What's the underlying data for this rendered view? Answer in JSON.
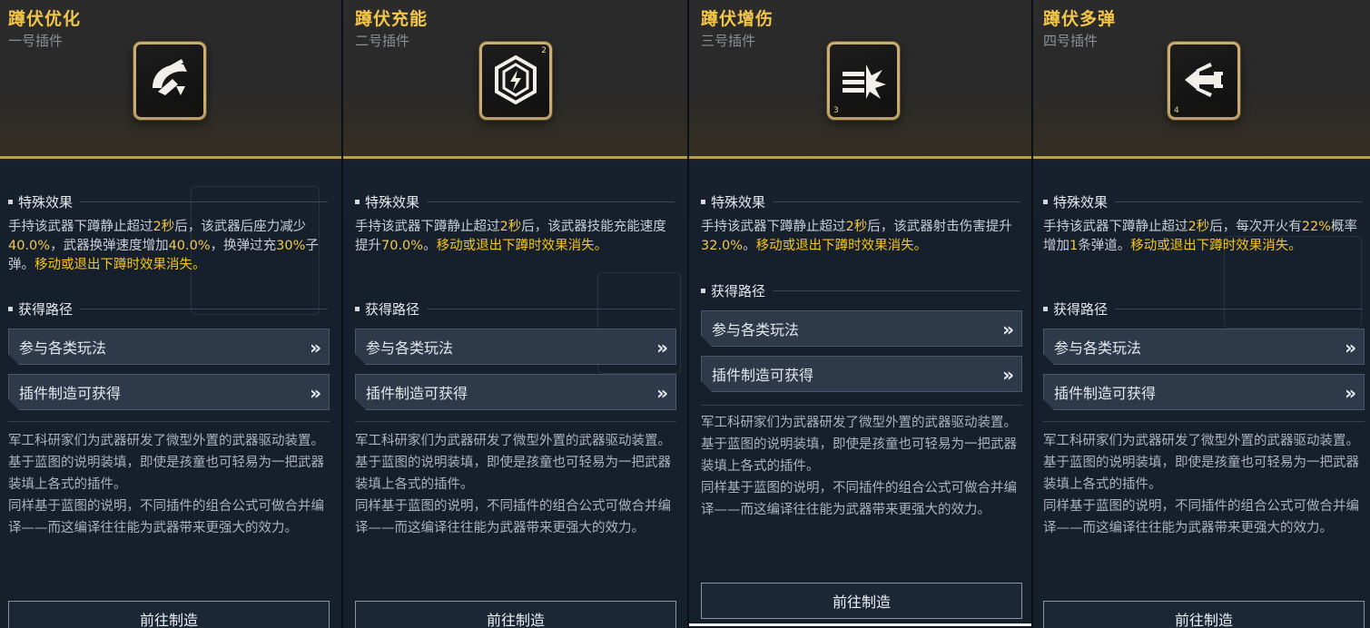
{
  "common": {
    "section_effect": "特殊效果",
    "section_route": "获得路径",
    "route_1": "参与各类玩法",
    "route_2": "插件制造可获得",
    "chevron": "»",
    "desc_1": "军工科研家们为武器研发了微型外置的武器驱动装置。",
    "desc_2": "基于蓝图的说明装填，即使是孩童也可轻易为一把武器装填上各式的插件。",
    "desc_3": "同样基于蓝图的说明，不同插件的组合公式可做合并编译——而这编译往往能为武器带来更强大的效力。",
    "goto_label": "前往制造"
  },
  "cards": [
    {
      "title": "蹲伏优化",
      "subtitle": "一号插件",
      "icon": "crouch-optimize-icon",
      "effect": {
        "p1": "手持该武器下蹲静止超过",
        "v1": "2秒",
        "p2": "后，该武器后座力减少",
        "v2": "40.0%",
        "p3": "，武器换弹速度增加",
        "v3": "40.0%",
        "p4": "，换弹过充",
        "v4": "30%",
        "p5": "子弹。",
        "end": "移动或退出下蹲时效果消失。"
      }
    },
    {
      "title": "蹲伏充能",
      "subtitle": "二号插件",
      "icon": "crouch-charge-icon",
      "badge": "2",
      "effect": {
        "p1": "手持该武器下蹲静止超过",
        "v1": "2秒",
        "p2": "后，该武器技能充能速度提升",
        "v2": "70.0%",
        "p3": "。",
        "end": "移动或退出下蹲时效果消失。"
      }
    },
    {
      "title": "蹲伏增伤",
      "subtitle": "三号插件",
      "icon": "crouch-damage-icon",
      "badge": "3",
      "effect": {
        "p1": "手持该武器下蹲静止超过",
        "v1": "2秒",
        "p2": "后，该武器射击伤害提升",
        "v2": "32.0%",
        "p3": "。",
        "end": "移动或退出下蹲时效果消失。"
      }
    },
    {
      "title": "蹲伏多弹",
      "subtitle": "四号插件",
      "icon": "crouch-multishot-icon",
      "badge": "4",
      "effect": {
        "p1": "手持该武器下蹲静止超过",
        "v1": "2秒",
        "p2": "后，每次开火有",
        "v2": "22%",
        "p3": "概率增加",
        "v3": "1",
        "p4": "条弹道。",
        "end": "移动或退出下蹲时效果消失。"
      }
    }
  ]
}
